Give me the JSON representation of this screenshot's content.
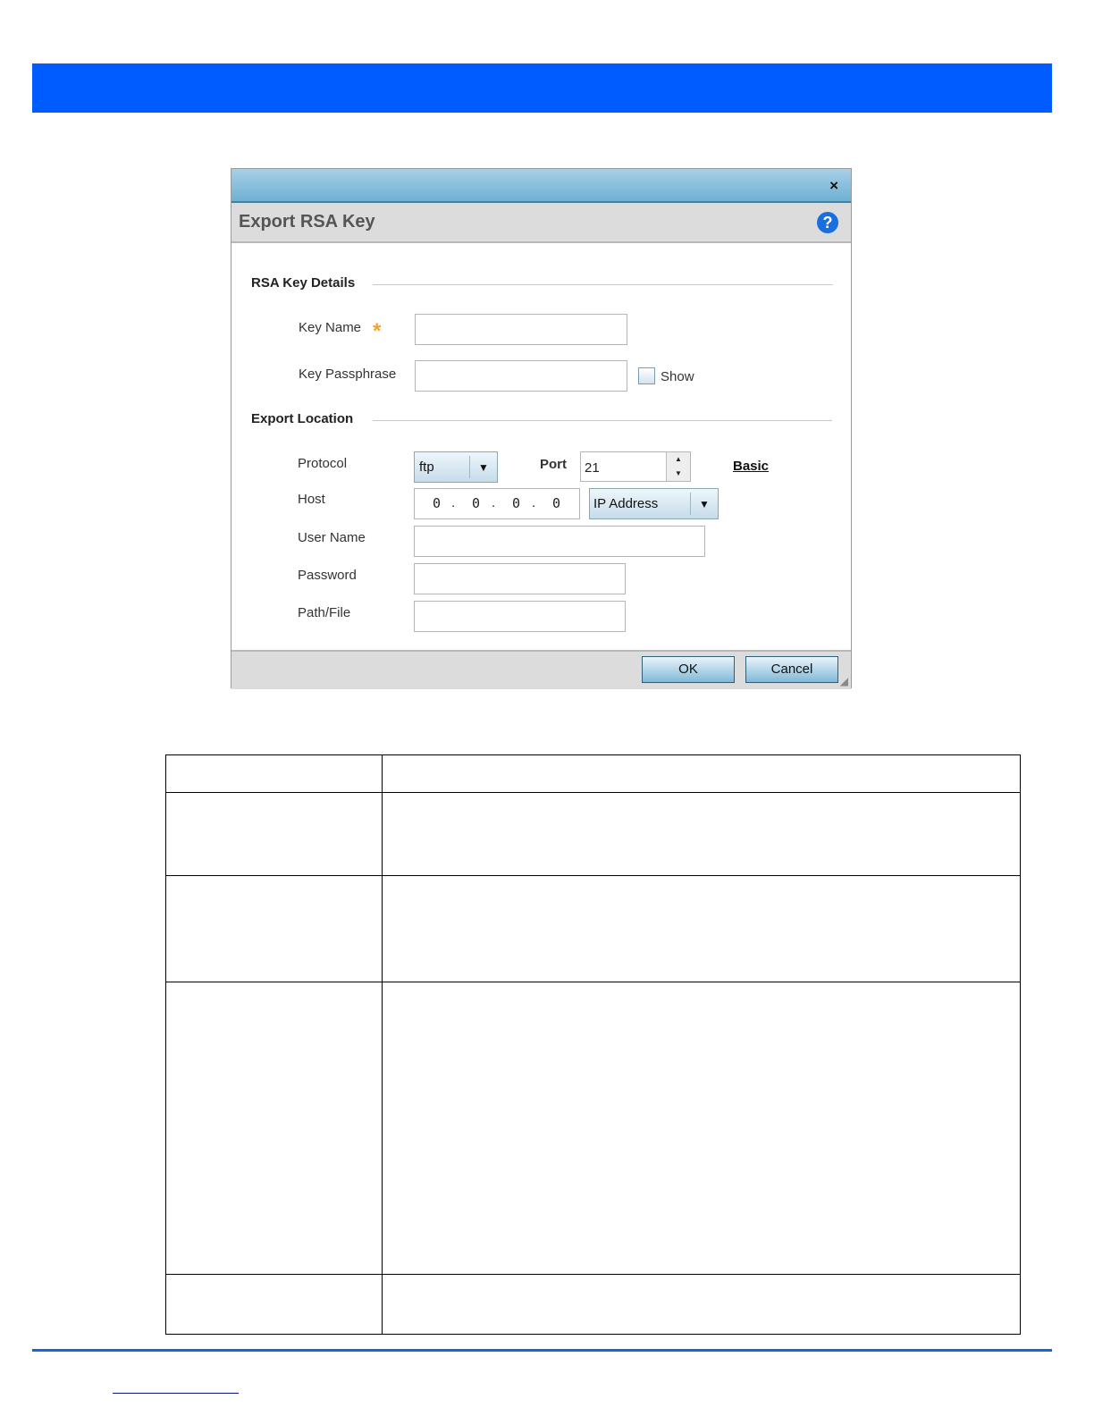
{
  "dialog": {
    "title": "Export RSA Key",
    "close_icon": "close-icon",
    "help_icon": "help-icon",
    "help_glyph": "?",
    "close_glyph": "×",
    "section_key_details": "RSA Key Details",
    "key_name_label": "Key Name",
    "required_marker": "*",
    "key_name_value": "",
    "key_passphrase_label": "Key Passphrase",
    "key_passphrase_value": "",
    "show_label": "Show",
    "show_checked": false,
    "section_export_location": "Export Location",
    "protocol_label": "Protocol",
    "protocol_value": "ftp",
    "port_label": "Port",
    "port_value": "21",
    "basic_link": "Basic",
    "host_label": "Host",
    "host_octets": [
      "0",
      "0",
      "0",
      "0"
    ],
    "host_type_value": "IP Address",
    "user_name_label": "User Name",
    "password_label": "Password",
    "path_file_label": "Path/File",
    "ok_label": "OK",
    "cancel_label": "Cancel"
  },
  "colors": {
    "banner": "#005cff",
    "accent_line": "#1466e0",
    "required": "#f5a030"
  }
}
